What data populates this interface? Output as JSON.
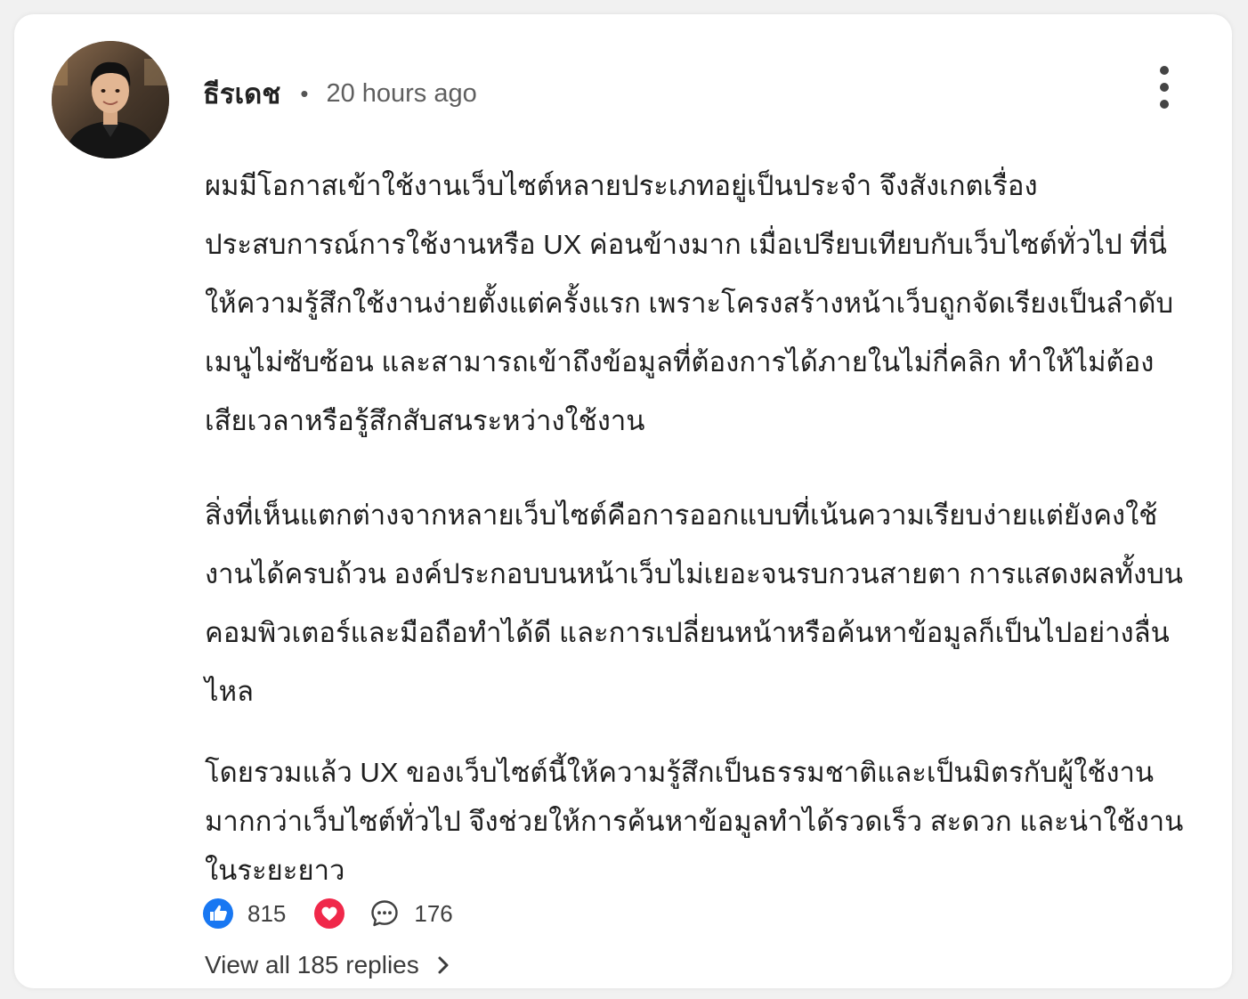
{
  "comment": {
    "author": "ธีรเดช",
    "separator": "•",
    "time": "20 hours ago",
    "paragraphs": [
      "ผมมีโอกาสเข้าใช้งานเว็บไซต์หลายประเภทอยู่เป็นประจำ จึงสังเกตเรื่องประสบการณ์การใช้งานหรือ UX ค่อนข้างมาก เมื่อเปรียบเทียบกับเว็บไซต์ทั่วไป ที่นี่ให้ความรู้สึกใช้งานง่ายตั้งแต่ครั้งแรก เพราะโครงสร้างหน้าเว็บถูกจัดเรียงเป็นลำดับ เมนูไม่ซับซ้อน และสามารถเข้าถึงข้อมูลที่ต้องการได้ภายในไม่กี่คลิก ทำให้ไม่ต้องเสียเวลาหรือรู้สึกสับสนระหว่างใช้งาน",
      "สิ่งที่เห็นแตกต่างจากหลายเว็บไซต์คือการออกแบบที่เน้นความเรียบง่ายแต่ยังคงใช้งานได้ครบถ้วน องค์ประกอบบนหน้าเว็บไม่เยอะจนรบกวนสายตา การแสดงผลทั้งบนคอมพิวเตอร์และมือถือทำได้ดี และการเปลี่ยนหน้าหรือค้นหาข้อมูลก็เป็นไปอย่างลื่นไหล",
      "โดยรวมแล้ว UX ของเว็บไซต์นี้ให้ความรู้สึกเป็นธรรมชาติและเป็นมิตรกับผู้ใช้งานมากกว่าเว็บไซต์ทั่วไป จึงช่วยให้การค้นหาข้อมูลทำได้รวดเร็ว สะดวก และน่าใช้งานในระยะยาว"
    ],
    "likes": "815",
    "comments": "176",
    "replies_link": "View all 185 replies"
  },
  "icons": {
    "like": "thumbs-up-icon",
    "love": "heart-icon",
    "comment": "chat-bubble-icon",
    "more": "more-vertical-icon",
    "chevron": "chevron-right-icon"
  },
  "colors": {
    "like_blue": "#1877f2",
    "love_red": "#f0284a"
  }
}
